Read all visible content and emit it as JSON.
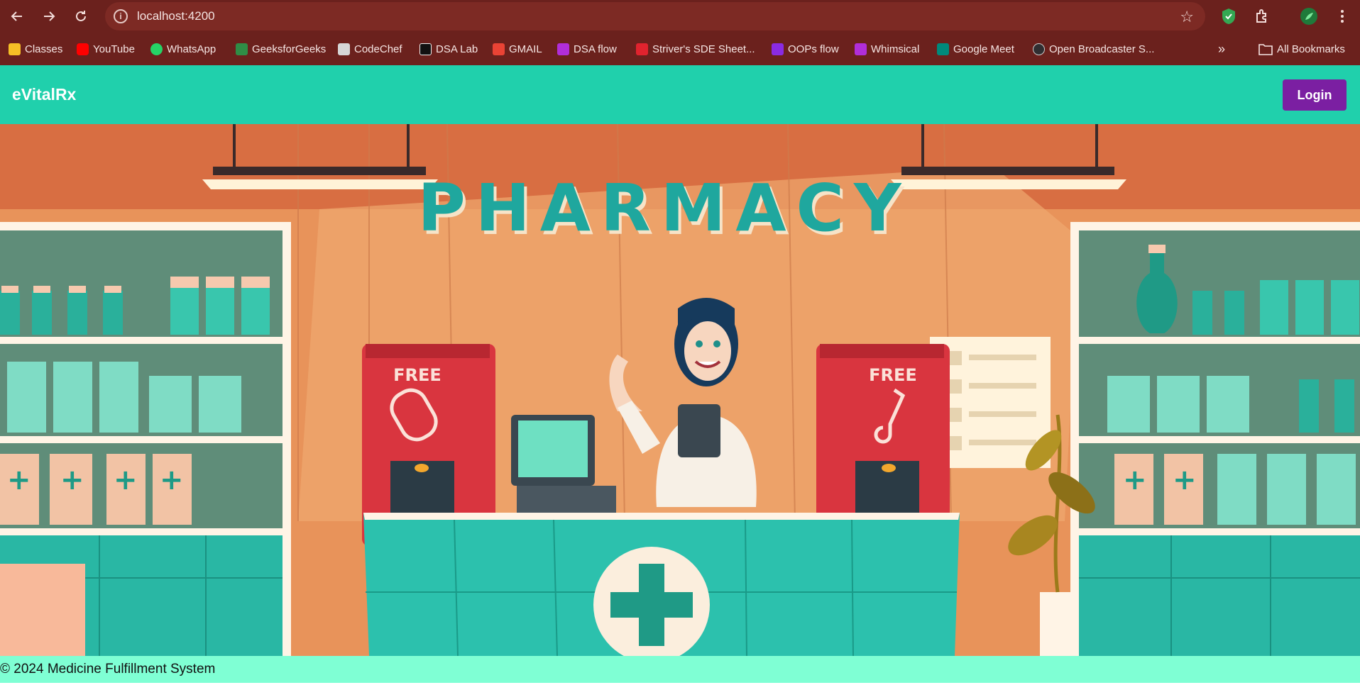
{
  "browser": {
    "url": "localhost:4200",
    "bookmarks": [
      {
        "label": "Classes",
        "icon": "classroom-icon",
        "color": "#f6c026"
      },
      {
        "label": "YouTube",
        "icon": "youtube-icon",
        "color": "#ff0000"
      },
      {
        "label": "WhatsApp",
        "icon": "whatsapp-icon",
        "color": "#25d366"
      },
      {
        "label": "GeeksforGeeks",
        "icon": "gfg-icon",
        "color": "#2f8d46"
      },
      {
        "label": "CodeChef",
        "icon": "codechef-icon",
        "color": "#d6d6d6"
      },
      {
        "label": "DSA Lab",
        "icon": "hackerrank-icon",
        "color": "#111111"
      },
      {
        "label": "GMAIL",
        "icon": "gmail-icon",
        "color": "#ea4335"
      },
      {
        "label": "DSA flow",
        "icon": "whimsical-icon",
        "color": "#b12ed9"
      },
      {
        "label": "Striver's SDE Sheet...",
        "icon": "tuf-icon",
        "color": "#e0232e"
      },
      {
        "label": "OOPs flow",
        "icon": "whimsical-icon",
        "color": "#8a2be2"
      },
      {
        "label": "Whimsical",
        "icon": "whimsical-icon",
        "color": "#b12ed9"
      },
      {
        "label": "Google Meet",
        "icon": "meet-icon",
        "color": "#00897b"
      },
      {
        "label": "Open Broadcaster S...",
        "icon": "obs-icon",
        "color": "#302e31"
      }
    ],
    "all_bookmarks": "All Bookmarks",
    "overflow": "»"
  },
  "header": {
    "brand": "eVitalRx",
    "login": "Login"
  },
  "hero": {
    "sign": "PHARMACY",
    "machine_label": "FREE"
  },
  "footer": {
    "text": "© 2024 Medicine Fulfillment System"
  },
  "colors": {
    "header": "#20d0ac",
    "login": "#7b1fa2",
    "footer": "#7fffd4",
    "chrome": "#6b211d"
  }
}
